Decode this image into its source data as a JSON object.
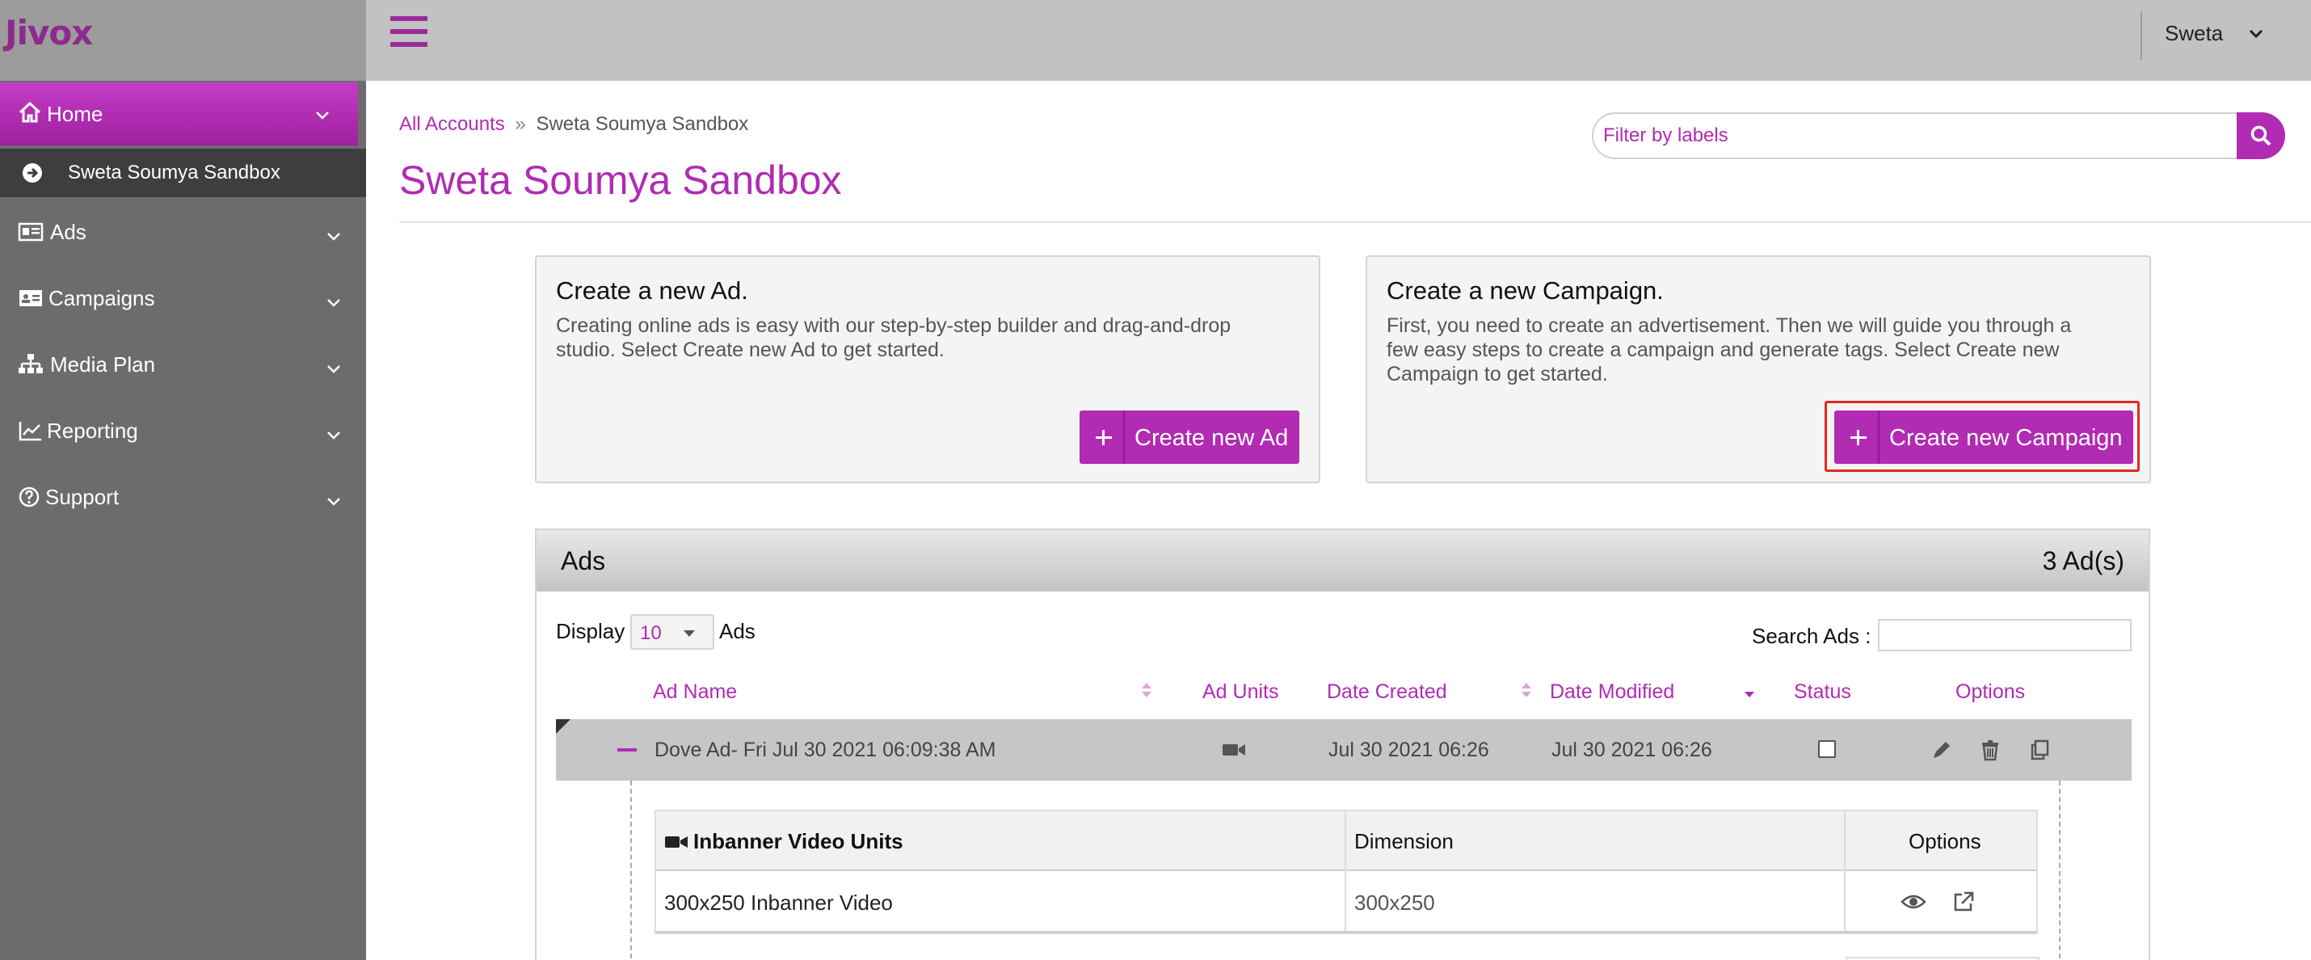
{
  "app": {
    "logo": "Jivox"
  },
  "user": {
    "name": "Sweta"
  },
  "sidebar": {
    "home": "Home",
    "sub_item": "Sweta Soumya Sandbox",
    "items": [
      {
        "label": "Ads",
        "icon": "id-card-icon"
      },
      {
        "label": "Campaigns",
        "icon": "address-card-icon"
      },
      {
        "label": "Media Plan",
        "icon": "sitemap-icon"
      },
      {
        "label": "Reporting",
        "icon": "line-chart-icon"
      },
      {
        "label": "Support",
        "icon": "question-circle-icon"
      }
    ]
  },
  "breadcrumb": {
    "root": "All Accounts",
    "separator": "»",
    "current": "Sweta Soumya Sandbox"
  },
  "page": {
    "title": "Sweta Soumya Sandbox"
  },
  "filter": {
    "placeholder": "Filter by labels"
  },
  "cards": {
    "ad": {
      "title": "Create a new Ad.",
      "line1": "Creating online ads is easy with our step-by-step builder and drag-and-drop",
      "line2": "studio. Select Create new Ad to get started.",
      "button": "Create new Ad"
    },
    "campaign": {
      "title": "Create a new Campaign.",
      "line1": "First, you need to create an advertisement. Then we will guide you through a",
      "line2": "few easy steps to create a campaign and generate tags. Select Create new",
      "line3": "Campaign to get started.",
      "button": "Create new Campaign"
    }
  },
  "ads_panel": {
    "title": "Ads",
    "count": "3 Ad(s)",
    "display_label": "Display",
    "display_value": "10",
    "display_suffix": "Ads",
    "search_label": "Search Ads :",
    "columns": {
      "name": "Ad Name",
      "units": "Ad Units",
      "created": "Date Created",
      "modified": "Date Modified",
      "status": "Status",
      "options": "Options"
    },
    "rows": [
      {
        "name": "Dove Ad- Fri Jul 30 2021 06:09:38 AM",
        "created": "Jul 30 2021 06:26",
        "modified": "Jul 30 2021 06:26"
      }
    ],
    "units_table": {
      "header_type": "Inbanner Video Units",
      "header_dimension": "Dimension",
      "header_options": "Options",
      "rows": [
        {
          "name": "300x250 Inbanner Video",
          "dimension": "300x250"
        }
      ]
    }
  },
  "colors": {
    "accent": "#b12bb3",
    "sidebar": "#6c6c6c",
    "topbar": "#c2c2c2",
    "highlight": "#e02a20"
  }
}
